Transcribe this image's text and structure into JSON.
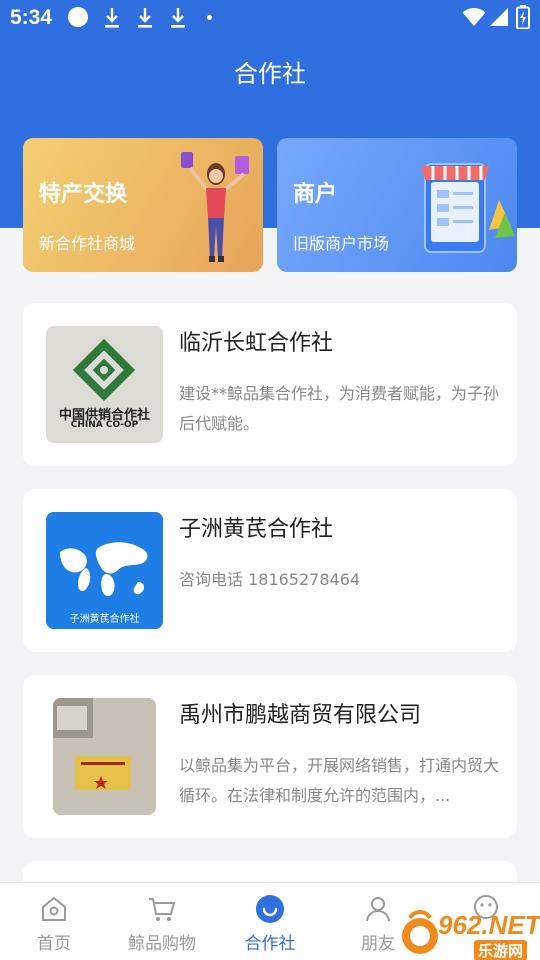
{
  "status_bar": {
    "time": "5:34",
    "icons": [
      "notification-dot-icon",
      "download-icon",
      "download-icon",
      "download-icon",
      "dot-icon",
      "wifi-icon",
      "signal-icon",
      "battery-icon"
    ]
  },
  "header": {
    "title": "合作社"
  },
  "promos": [
    {
      "title": "特产交换",
      "subtitle": "新合作社商城",
      "icon": "shopping-woman-illustration"
    },
    {
      "title": "商户",
      "subtitle": "旧版商户市场",
      "icon": "phone-store-illustration"
    }
  ],
  "cooperatives": [
    {
      "name": "临沂长虹合作社",
      "description": "建设**鲸品集合作社，为消费者赋能，为子孙后代赋能。",
      "logo_caption": "中国供销合作社",
      "logo_caption_en": "CHINA CO-OP"
    },
    {
      "name": "子洲黄芪合作社",
      "description": "咨询电话 18165278464",
      "logo_caption": "子洲黄芪合作社"
    },
    {
      "name": "禹州市鹏越商贸有限公司",
      "description": "以鲸品集为平台，开展网络销售，打通内贸大循环。在法律和制度允许的范围内，..."
    }
  ],
  "tabs": [
    {
      "label": "首页",
      "icon": "home-icon",
      "active": false
    },
    {
      "label": "鲸品购物",
      "icon": "cart-icon",
      "active": false
    },
    {
      "label": "合作社",
      "icon": "cooperative-icon",
      "active": true
    },
    {
      "label": "朋友",
      "icon": "friend-icon",
      "active": false
    },
    {
      "label": "",
      "icon": "smiley-icon",
      "active": false
    }
  ],
  "watermark": {
    "text": "962.NET",
    "subtext": "乐游网"
  },
  "colors": {
    "primary": "#2f6fe0",
    "background": "#f3f4f6",
    "card": "#ffffff",
    "muted_text": "#888888"
  }
}
